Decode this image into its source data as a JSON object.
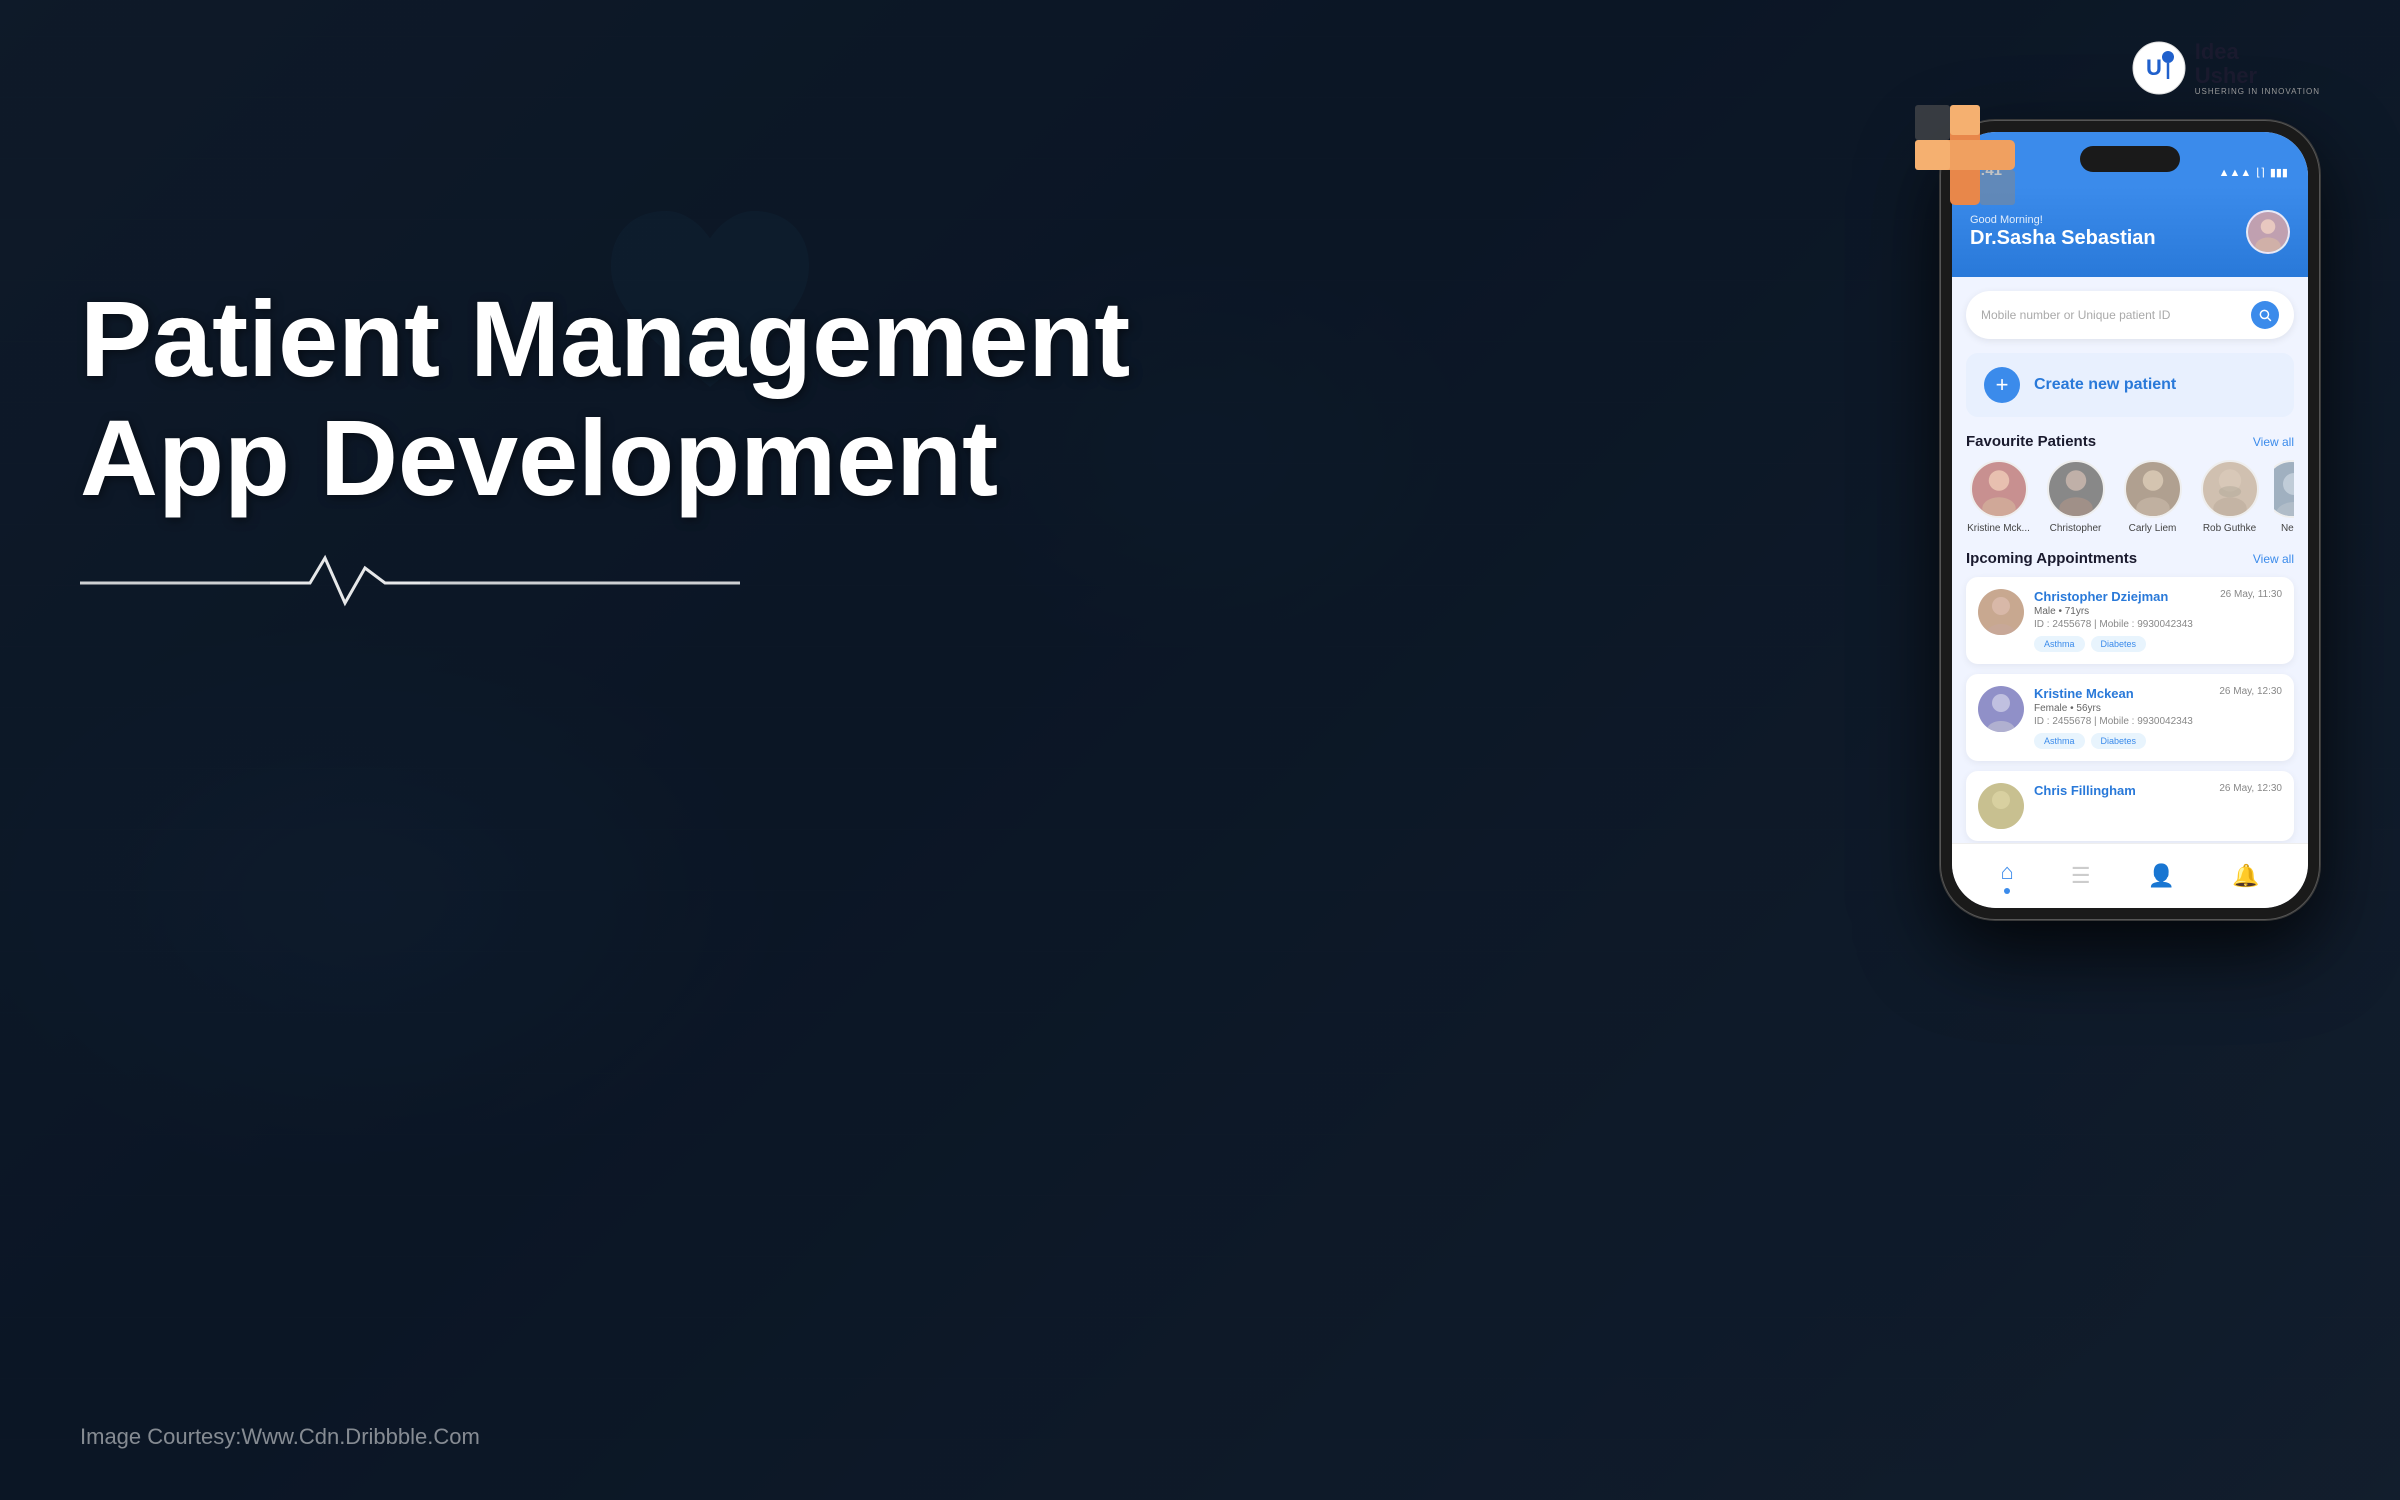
{
  "background": {
    "color": "#1a2a3a"
  },
  "logo": {
    "idea": "Idea",
    "usher": "Usher",
    "subtitle": "USHERING IN INNOVATION"
  },
  "left_panel": {
    "title_line1": "Patient Management",
    "title_line2": "App Development"
  },
  "image_courtesy": "Image Courtesy:Www.Cdn.Dribbble.Com",
  "phone": {
    "status_bar": {
      "time": "9:41",
      "signal": "▲▲▲",
      "wifi": "WiFi",
      "battery": "Battery"
    },
    "header": {
      "greeting": "Good Morning!",
      "doctor_name": "Dr.Sasha Sebastian"
    },
    "search": {
      "placeholder": "Mobile number or Unique patient ID"
    },
    "create_patient": {
      "label": "Create new patient"
    },
    "favourite_patients": {
      "title": "Favourite Patients",
      "view_all": "View all",
      "patients": [
        {
          "name": "Kristine Mck...",
          "avatar_color": "#c89090"
        },
        {
          "name": "Christopher",
          "avatar_color": "#888888"
        },
        {
          "name": "Carly Liem",
          "avatar_color": "#b0a090"
        },
        {
          "name": "Rob Guthke",
          "avatar_color": "#d0c0b0"
        },
        {
          "name": "Ne...",
          "avatar_color": "#a0b0c0"
        }
      ]
    },
    "upcoming_appointments": {
      "title": "Ipcoming Appointments",
      "view_all": "View all",
      "appointments": [
        {
          "name": "Christopher Dziejman",
          "date": "26 May, 11:30",
          "details": "Male • 71yrs",
          "id": "ID : 2455678  |  Mobile : 9930042343",
          "tags": [
            "Asthma",
            "Diabetes"
          ],
          "avatar_color": "#c8a090"
        },
        {
          "name": "Kristine Mckean",
          "date": "26 May, 12:30",
          "details": "Female • 56yrs",
          "id": "ID : 2455678  |  Mobile : 9930042343",
          "tags": [
            "Asthma",
            "Diabetes"
          ],
          "avatar_color": "#9090c8"
        },
        {
          "name": "Chris Fillingham",
          "date": "26 May, 12:30",
          "details": "",
          "id": "",
          "tags": [],
          "avatar_color": "#c8c090"
        }
      ]
    },
    "nav": {
      "items": [
        "🏠",
        "☰",
        "👤",
        "🔔"
      ]
    }
  }
}
